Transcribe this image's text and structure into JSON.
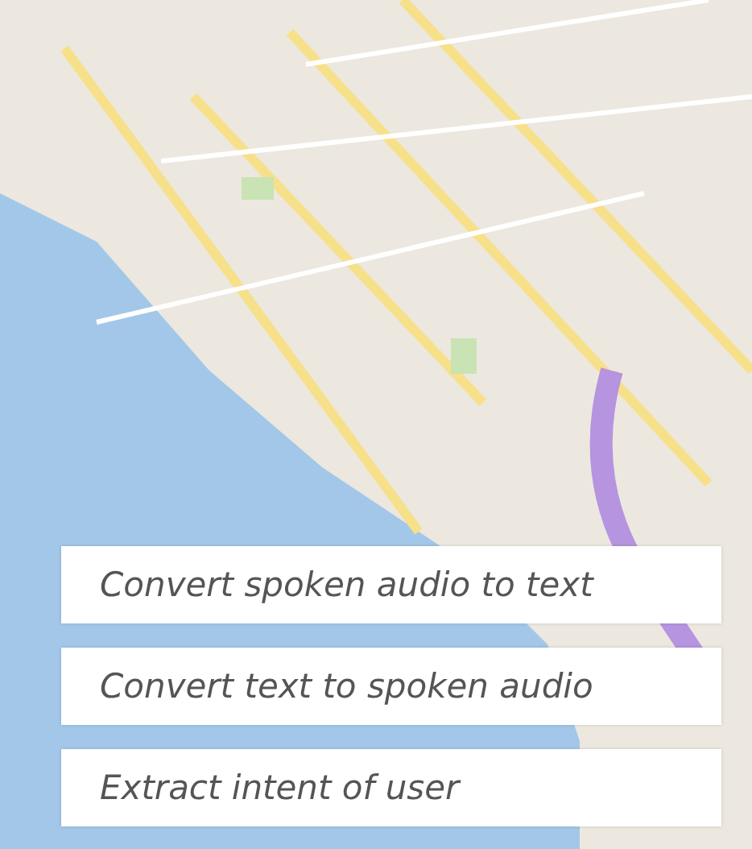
{
  "cards": [
    {
      "label": "Convert spoken audio to text"
    },
    {
      "label": "Convert text to spoken audio"
    },
    {
      "label": "Extract intent of user"
    }
  ]
}
